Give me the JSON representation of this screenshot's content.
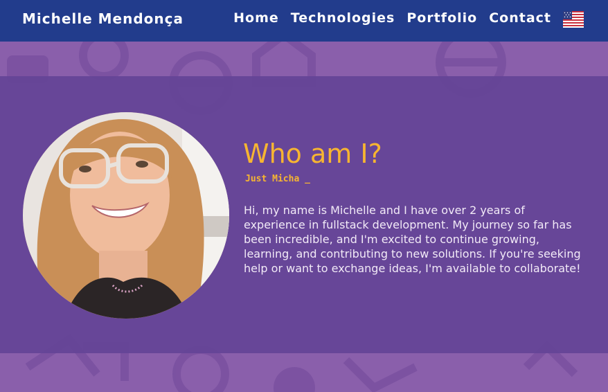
{
  "header": {
    "brand": "Michelle Mendonça",
    "nav": [
      {
        "label": "Home"
      },
      {
        "label": "Technologies"
      },
      {
        "label": "Portfolio"
      },
      {
        "label": "Contact"
      }
    ],
    "language_icon": "us-flag-icon"
  },
  "about": {
    "title": "Who am I?",
    "typing_text": "Just Micha _",
    "bio": "Hi, my name is Michelle and I have over 2 years of experience in fullstack development. My journey so far has been incredible, and I'm excited to continue growing, learning, and contributing to new solutions. If you're seeking help or want to exchange ideas, I'm available to collaborate!"
  },
  "colors": {
    "nav_background": "#223c8c",
    "page_background": "#8a5fab",
    "panel_background": "#644496",
    "accent": "#f7b531",
    "text": "#f2eaf7"
  }
}
